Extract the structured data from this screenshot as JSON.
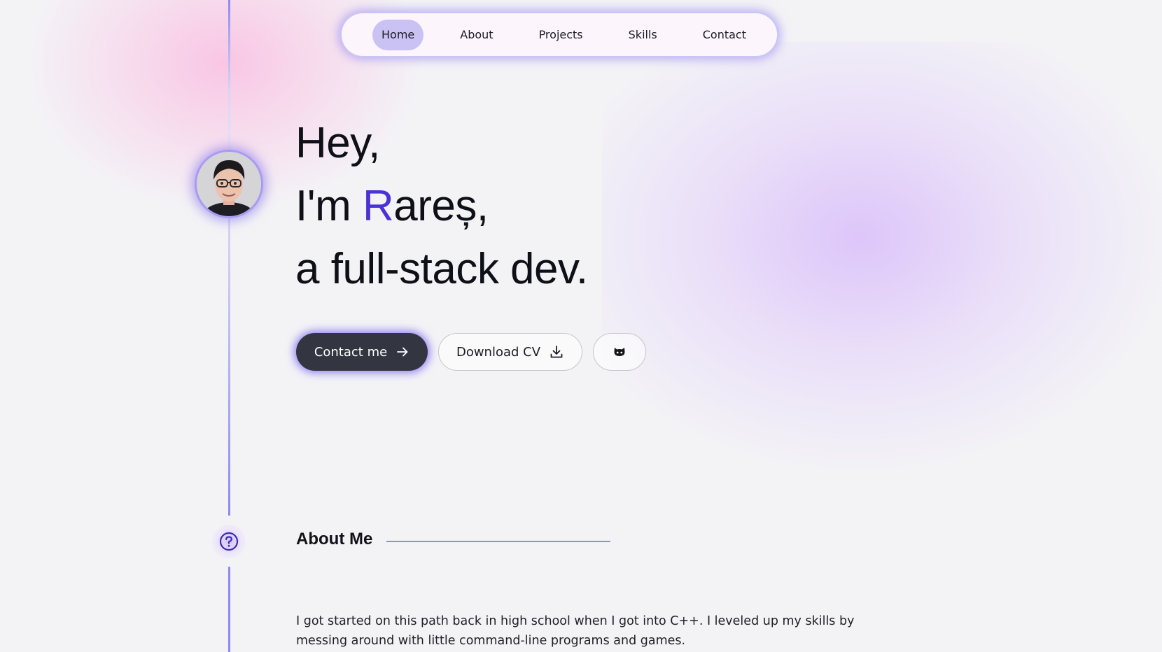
{
  "nav": {
    "items": [
      {
        "label": "Home",
        "active": true
      },
      {
        "label": "About",
        "active": false
      },
      {
        "label": "Projects",
        "active": false
      },
      {
        "label": "Skills",
        "active": false
      },
      {
        "label": "Contact",
        "active": false
      }
    ]
  },
  "hero": {
    "line1": "Hey,",
    "line2_prefix": "I'm ",
    "line2_accent": "R",
    "line2_rest": "areș,",
    "line3": "a full-stack dev."
  },
  "buttons": {
    "contact": "Contact me",
    "download_cv": "Download CV",
    "github_icon": "github-icon"
  },
  "about": {
    "title": "About Me",
    "text": "I got started on this path back in high school when I got into C++. I leveled up my skills by messing around with little command-line programs and games."
  },
  "colors": {
    "accent": "#4a33d6",
    "timeline": "#8c8af0",
    "primary_button": "#333540",
    "nav_active": "#cbc2f4"
  }
}
